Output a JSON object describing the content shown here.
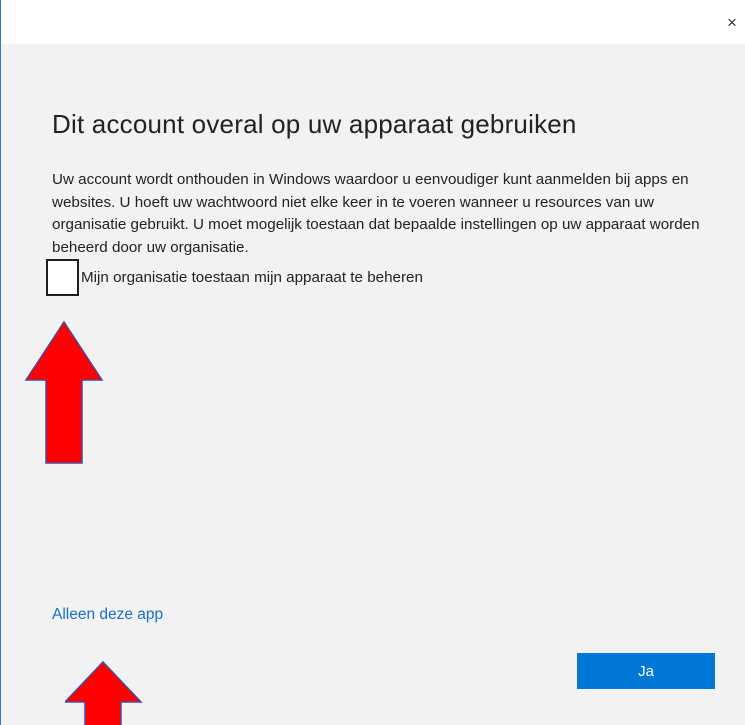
{
  "window": {
    "close_icon": "close-icon",
    "close_glyph": "×"
  },
  "main": {
    "heading": "Dit account overal op uw apparaat gebruiken",
    "paragraph": "Uw account wordt onthouden in Windows waardoor u eenvoudiger kunt aanmelden bij apps en websites. U hoeft uw wachtwoord niet elke keer in te voeren wanneer u resources van uw organisatie gebruikt. U moet mogelijk toestaan dat bepaalde instellingen op uw apparaat worden beheerd door uw organisatie.",
    "checkbox_label": "Mijn organisatie toestaan mijn apparaat te beheren",
    "checkbox_checked": false,
    "link_label": "Alleen deze app",
    "yes_button": "Ja"
  },
  "annotations": {
    "arrow_color": "#ff0000",
    "arrow_outline": "#4a4a9a",
    "arrow_icon": "red-up-arrow-icon"
  },
  "colors": {
    "accent": "#0078d7",
    "link": "#1a6fc7"
  }
}
